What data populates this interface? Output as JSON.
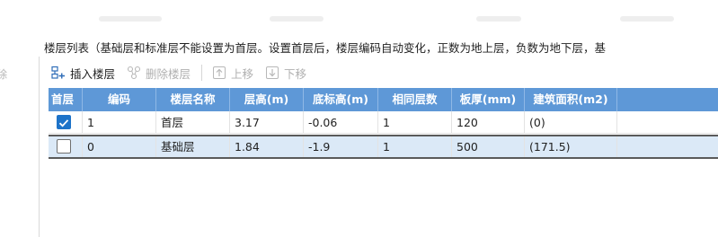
{
  "description": "楼层列表（基础层和标准层不能设置为首层。设置首层后，楼层编码自动变化，正数为地上层，负数为地下层，基",
  "left_panel": {
    "delete_label": "除"
  },
  "toolbar": {
    "insert_floor": "插入楼层",
    "delete_floor": "删除楼层",
    "move_up": "上移",
    "move_down": "下移"
  },
  "table": {
    "headers": {
      "first_floor": "首层",
      "code": "编码",
      "name": "楼层名称",
      "height": "层高(m)",
      "base_elevation": "底标高(m)",
      "same_count": "相同层数",
      "slab_thickness": "板厚(mm)",
      "area": "建筑面积(m2)"
    },
    "rows": [
      {
        "first_floor": true,
        "code": "1",
        "name": "首层",
        "height": "3.17",
        "base_elevation": "-0.06",
        "same_count": "1",
        "slab_thickness": "120",
        "area": "(0)"
      },
      {
        "first_floor": false,
        "code": "0",
        "name": "基础层",
        "height": "1.84",
        "base_elevation": "-1.9",
        "same_count": "1",
        "slab_thickness": "500",
        "area": "(171.5)"
      }
    ]
  },
  "colors": {
    "header_bg": "#5e98d7",
    "selected_row_bg": "#dbe9f7",
    "checkbox_checked": "#1d73c9"
  }
}
